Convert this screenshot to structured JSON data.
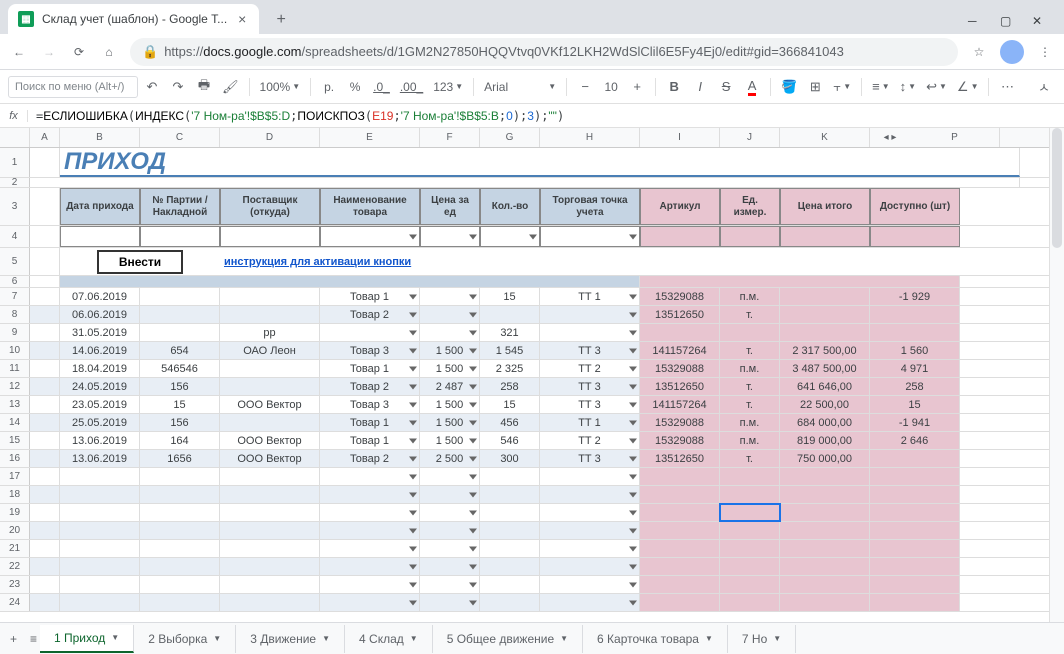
{
  "browser": {
    "tab_title": "Склад учет (шаблон) - Google Т...",
    "url_prefix": "https://",
    "url_host": "docs.google.com",
    "url_path": "/spreadsheets/d/1GM2N27850HQQVtvq0VKf12LKH2WdSlClil6E5Fy4Ej0/edit#gid=366841043"
  },
  "toolbar": {
    "search_placeholder": "Поиск по меню (Alt+/)",
    "zoom": "100%",
    "currency": "р.",
    "percent": "%",
    "dec_dec": ".0_",
    "dec_inc": ".00_",
    "more_fmt": "123",
    "font": "Arial",
    "size": "10"
  },
  "formula": {
    "f1": "ЕСЛИОШИБКА",
    "f2": "ИНДЕКС",
    "s1": "'7 Ном-ра'!$B$5:D",
    "f3": "ПОИСКПОЗ",
    "ref1": "E19",
    "s2": "'7 Ном-ра'!$B$5:B",
    "n0": "0",
    "n3": "3",
    "empty": "\"\""
  },
  "cols": [
    "A",
    "B",
    "C",
    "D",
    "E",
    "F",
    "G",
    "H",
    "I",
    "J",
    "K",
    "P"
  ],
  "title": "ПРИХОД",
  "headers": [
    "Дата прихода",
    "№ Партии / Накладной",
    "Поставщик (откуда)",
    "Наименование товара",
    "Цена за ед",
    "Кол.-во",
    "Торговая точка учета",
    "Артикул",
    "Ед. измер.",
    "Цена итого",
    "Доступно (шт)"
  ],
  "btn": "Внести",
  "link": "инструкция для активации кнопки",
  "rows": [
    {
      "n": "7",
      "d": "07.06.2019",
      "p": "",
      "s": "",
      "t": "Товар 1",
      "price": "",
      "q": "15",
      "pt": "ТТ 1",
      "art": "15329088",
      "u": "п.м.",
      "tot": "",
      "av": "-1 929"
    },
    {
      "n": "8",
      "d": "06.06.2019",
      "p": "",
      "s": "",
      "t": "Товар 2",
      "price": "",
      "q": "",
      "pt": "",
      "art": "13512650",
      "u": "т.",
      "tot": "",
      "av": ""
    },
    {
      "n": "9",
      "d": "31.05.2019",
      "p": "",
      "s": "рр",
      "t": "",
      "price": "",
      "q": "321",
      "pt": "",
      "art": "",
      "u": "",
      "tot": "",
      "av": ""
    },
    {
      "n": "10",
      "d": "14.06.2019",
      "p": "654",
      "s": "ОАО Леон",
      "t": "Товар 3",
      "price": "1 500",
      "q": "1 545",
      "pt": "ТТ 3",
      "art": "141157264",
      "u": "т.",
      "tot": "2 317 500,00",
      "av": "1 560"
    },
    {
      "n": "11",
      "d": "18.04.2019",
      "p": "546546",
      "s": "",
      "t": "Товар 1",
      "price": "1 500",
      "q": "2 325",
      "pt": "ТТ 2",
      "art": "15329088",
      "u": "п.м.",
      "tot": "3 487 500,00",
      "av": "4 971"
    },
    {
      "n": "12",
      "d": "24.05.2019",
      "p": "156",
      "s": "",
      "t": "Товар 2",
      "price": "2 487",
      "q": "258",
      "pt": "ТТ 3",
      "art": "13512650",
      "u": "т.",
      "tot": "641 646,00",
      "av": "258"
    },
    {
      "n": "13",
      "d": "23.05.2019",
      "p": "15",
      "s": "ООО Вектор",
      "t": "Товар 3",
      "price": "1 500",
      "q": "15",
      "pt": "ТТ 3",
      "art": "141157264",
      "u": "т.",
      "tot": "22 500,00",
      "av": "15"
    },
    {
      "n": "14",
      "d": "25.05.2019",
      "p": "156",
      "s": "",
      "t": "Товар 1",
      "price": "1 500",
      "q": "456",
      "pt": "ТТ 1",
      "art": "15329088",
      "u": "п.м.",
      "tot": "684 000,00",
      "av": "-1 941"
    },
    {
      "n": "15",
      "d": "13.06.2019",
      "p": "164",
      "s": "ООО Вектор",
      "t": "Товар 1",
      "price": "1 500",
      "q": "546",
      "pt": "ТТ 2",
      "art": "15329088",
      "u": "п.м.",
      "tot": "819 000,00",
      "av": "2 646"
    },
    {
      "n": "16",
      "d": "13.06.2019",
      "p": "1656",
      "s": "ООО Вектор",
      "t": "Товар 2",
      "price": "2 500",
      "q": "300",
      "pt": "ТТ 3",
      "art": "13512650",
      "u": "т.",
      "tot": "750 000,00",
      "av": ""
    }
  ],
  "empty_rows": [
    "17",
    "18",
    "19",
    "20",
    "21",
    "22",
    "23",
    "24"
  ],
  "sheets": [
    "1 Приход",
    "2 Выборка",
    "3 Движение",
    "4 Склад",
    "5 Общее движение",
    "6 Карточка товара",
    "7 Но"
  ],
  "widths": {
    "A": 30,
    "B": 80,
    "C": 80,
    "D": 100,
    "E": 100,
    "F": 60,
    "G": 60,
    "H": 100,
    "I": 80,
    "J": 60,
    "K": 90,
    "P": 90
  }
}
